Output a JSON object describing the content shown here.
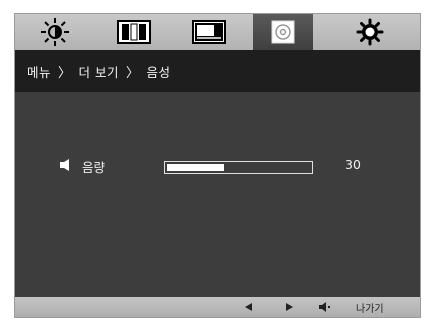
{
  "tabs": [
    {
      "icon": "brightness-icon",
      "active": false
    },
    {
      "icon": "contrast-icon",
      "active": false
    },
    {
      "icon": "picture-icon",
      "active": false
    },
    {
      "icon": "sound-icon",
      "active": true
    },
    {
      "icon": "settings-gear-icon",
      "active": false
    }
  ],
  "breadcrumb": {
    "items": [
      "메뉴",
      "더 보기",
      "음성"
    ],
    "separator": "〉"
  },
  "volume": {
    "icon": "speaker-icon",
    "label": "음량",
    "value": "30",
    "level_fraction": 0.4
  },
  "bottom_bar": {
    "left_label_icon": "left-arrow-icon",
    "right_label_icon": "right-arrow-icon",
    "volume_icon": "speaker-icon",
    "exit_label": "나가기"
  },
  "colors": {
    "panel": "#3d3d3d",
    "breadcrumb_bar": "#1e1e1e",
    "tab_bar": "#bdbdbd",
    "active_tab": "#4a4a4a",
    "slider_fill": "#ffffff"
  }
}
